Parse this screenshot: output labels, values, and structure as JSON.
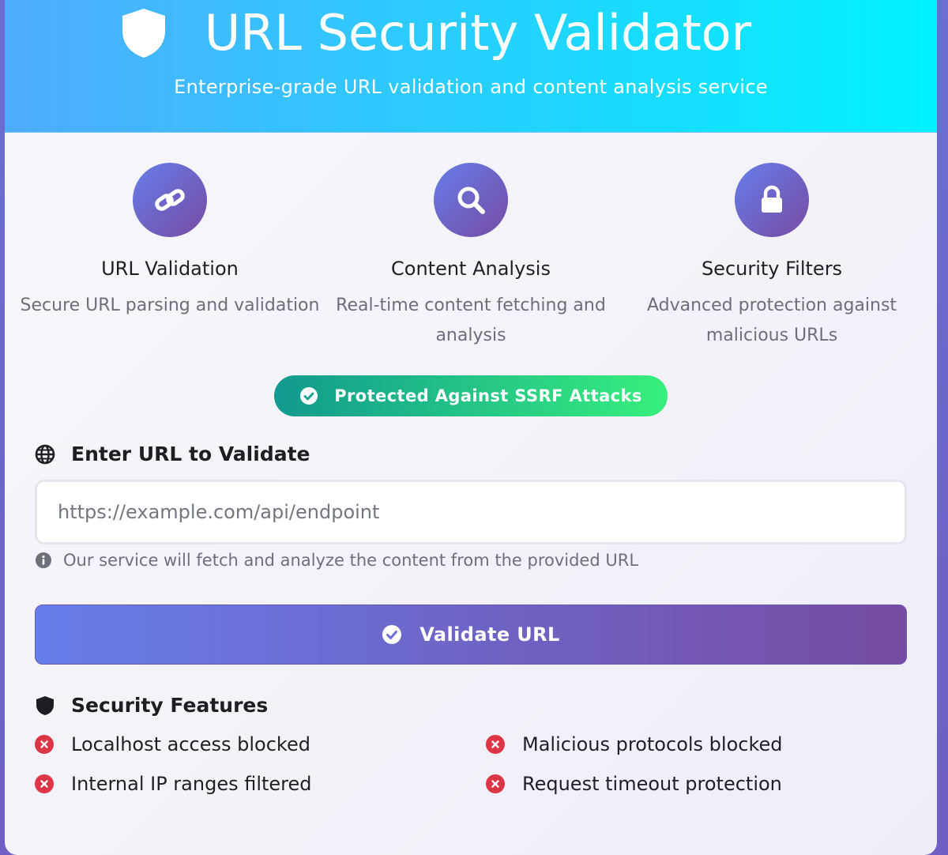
{
  "header": {
    "title": "URL Security Validator",
    "subtitle": "Enterprise-grade URL validation and content analysis service",
    "icon": "shield-icon"
  },
  "features": [
    {
      "title": "URL Validation",
      "description": "Secure URL parsing and validation",
      "icon": "link-icon"
    },
    {
      "title": "Content Analysis",
      "description": "Real-time content fetching and analysis",
      "icon": "search-icon"
    },
    {
      "title": "Security Filters",
      "description": "Advanced protection against malicious URLs",
      "icon": "lock-icon"
    }
  ],
  "badge": {
    "label": "Protected Against SSRF Attacks",
    "icon": "check-circle-icon"
  },
  "url_form": {
    "label": "Enter URL to Validate",
    "label_icon": "globe-icon",
    "value": "",
    "placeholder": "https://example.com/api/endpoint",
    "hint": "Our service will fetch and analyze the content from the provided URL",
    "hint_icon": "info-icon",
    "submit_label": "Validate URL",
    "submit_icon": "check-circle-icon"
  },
  "security_features": {
    "title": "Security Features",
    "title_icon": "shield-icon",
    "items": [
      {
        "label": "Localhost access blocked",
        "icon": "x-circle-icon"
      },
      {
        "label": "Malicious protocols blocked",
        "icon": "x-circle-icon"
      },
      {
        "label": "Internal IP ranges filtered",
        "icon": "x-circle-icon"
      },
      {
        "label": "Request timeout protection",
        "icon": "x-circle-icon"
      }
    ]
  },
  "colors": {
    "header_gradient": [
      "#4facfe",
      "#00f2fe"
    ],
    "accent_gradient": [
      "#667eea",
      "#764ba2"
    ],
    "badge_gradient": [
      "#11998e",
      "#38ef7d"
    ],
    "danger": "#dc3545"
  }
}
